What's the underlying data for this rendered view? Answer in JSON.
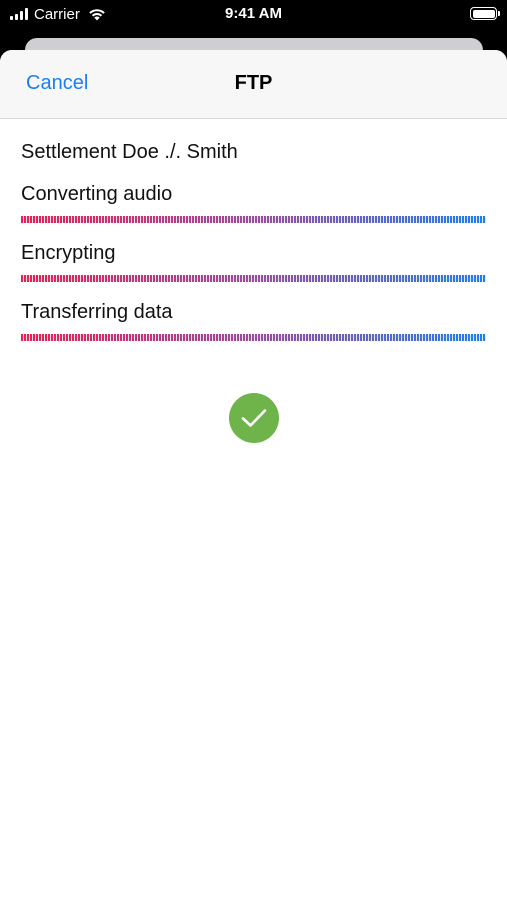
{
  "status_bar": {
    "carrier": "Carrier",
    "time": "9:41 AM",
    "signal_icon": "cellular-signal-icon",
    "wifi_icon": "wifi-icon",
    "battery_icon": "battery-icon",
    "battery_level": 1.0
  },
  "nav": {
    "cancel_label": "Cancel",
    "title": "FTP",
    "accent_color": "#1a7ff5"
  },
  "file_name": "Settlement Doe ./. Smith",
  "steps": [
    {
      "label": "Converting audio",
      "progress": 1.0
    },
    {
      "label": "Encrypting",
      "progress": 1.0
    },
    {
      "label": "Transferring data",
      "progress": 1.0
    }
  ],
  "progress_colors": [
    "#e4234f",
    "#9a4d9d",
    "#1f7fe8"
  ],
  "completion": {
    "icon": "checkmark-circle-icon",
    "color": "#6fb44a"
  }
}
